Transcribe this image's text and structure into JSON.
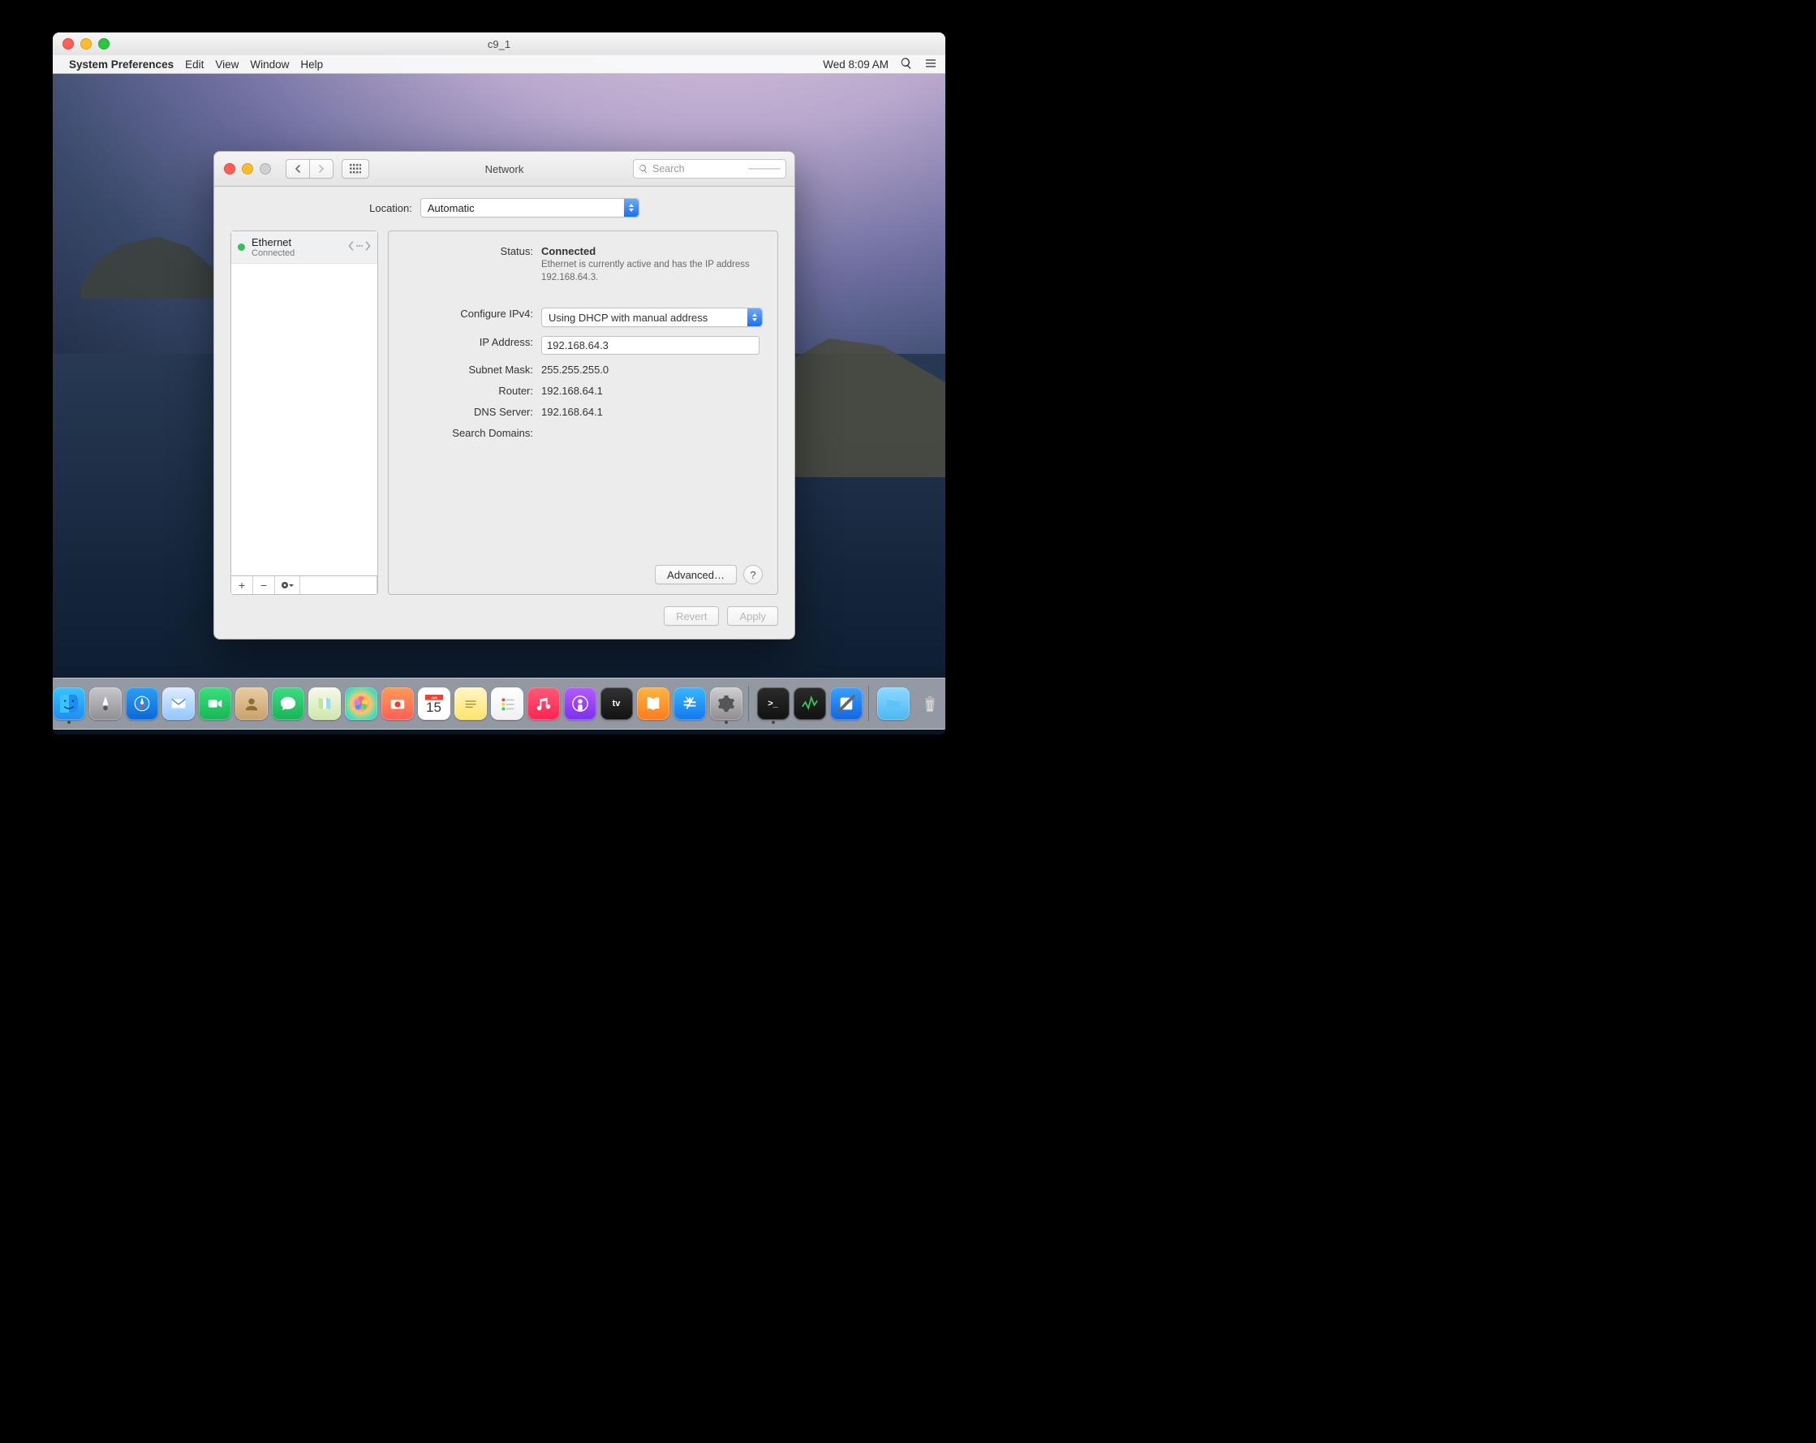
{
  "vm": {
    "title": "c9_1"
  },
  "menubar": {
    "app": "System Preferences",
    "items": [
      "Edit",
      "View",
      "Window",
      "Help"
    ],
    "clock": "Wed 8:09 AM"
  },
  "prefs": {
    "title": "Network",
    "search_placeholder": "Search",
    "location_label": "Location:",
    "location_value": "Automatic",
    "services": [
      {
        "name": "Ethernet",
        "status": "Connected"
      }
    ],
    "detail": {
      "status_label": "Status:",
      "status_value": "Connected",
      "status_desc": "Ethernet is currently active and has the IP address 192.168.64.3.",
      "configure_label": "Configure IPv4:",
      "configure_value": "Using DHCP with manual address",
      "ip_label": "IP Address:",
      "ip_value": "192.168.64.3",
      "subnet_label": "Subnet Mask:",
      "subnet_value": "255.255.255.0",
      "router_label": "Router:",
      "router_value": "192.168.64.1",
      "dns_label": "DNS Server:",
      "dns_placeholder": "192.168.64.1",
      "search_label": "Search Domains:",
      "advanced": "Advanced…"
    },
    "footer": {
      "revert": "Revert",
      "apply": "Apply"
    }
  },
  "dock": [
    {
      "name": "finder",
      "label": "",
      "ind": true
    },
    {
      "name": "launchpad",
      "label": ""
    },
    {
      "name": "safari",
      "label": ""
    },
    {
      "name": "mail",
      "label": ""
    },
    {
      "name": "facetime",
      "label": ""
    },
    {
      "name": "contacts",
      "label": ""
    },
    {
      "name": "messages",
      "label": ""
    },
    {
      "name": "maps",
      "label": ""
    },
    {
      "name": "photos",
      "label": ""
    },
    {
      "name": "photobooth",
      "label": ""
    },
    {
      "name": "calendar",
      "label": "15"
    },
    {
      "name": "notes",
      "label": ""
    },
    {
      "name": "reminders",
      "label": ""
    },
    {
      "name": "music",
      "label": ""
    },
    {
      "name": "podcasts",
      "label": ""
    },
    {
      "name": "tv",
      "label": "tv"
    },
    {
      "name": "books",
      "label": ""
    },
    {
      "name": "appstore",
      "label": ""
    },
    {
      "name": "sysprefs",
      "label": "",
      "ind": true
    },
    {
      "sep": true
    },
    {
      "name": "terminal",
      "label": ">_",
      "ind": true
    },
    {
      "name": "activity",
      "label": ""
    },
    {
      "name": "xcode",
      "label": ""
    },
    {
      "sep": true
    },
    {
      "name": "downloads",
      "label": "",
      "folder": true
    },
    {
      "name": "trash",
      "label": "",
      "trash": true
    }
  ]
}
